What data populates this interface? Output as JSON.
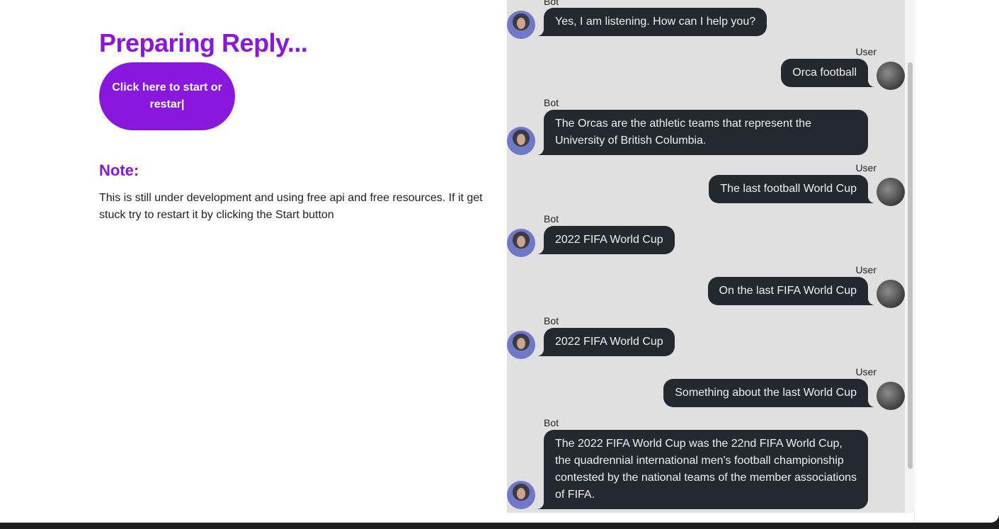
{
  "left_panel": {
    "title": "Preparing Reply...",
    "start_button_label": "Click here to start or restar|",
    "note_heading": "Note:",
    "note_text": "This is still under development and using free api and free resources. If it get stuck try to restart it by clicking the Start button"
  },
  "chat": {
    "messages": [
      {
        "sender": "Bot",
        "text": "Yes, I am listening. How can I help you?"
      },
      {
        "sender": "User",
        "text": "Orca football"
      },
      {
        "sender": "Bot",
        "text": "The Orcas are the athletic teams that represent the University of British Columbia."
      },
      {
        "sender": "User",
        "text": "The last football World Cup"
      },
      {
        "sender": "Bot",
        "text": "2022 FIFA World Cup"
      },
      {
        "sender": "User",
        "text": "On the last FIFA World Cup"
      },
      {
        "sender": "Bot",
        "text": "2022 FIFA World Cup"
      },
      {
        "sender": "User",
        "text": "Something about the last World Cup"
      },
      {
        "sender": "Bot",
        "text": "The 2022 FIFA World Cup was the 22nd FIFA World Cup, the quadrennial international men's football championship contested by the national teams of the member associations of FIFA."
      }
    ]
  },
  "colors": {
    "accent": "#8a17de",
    "bubble": "#24292f",
    "chat_bg": "#e0e0e0"
  }
}
